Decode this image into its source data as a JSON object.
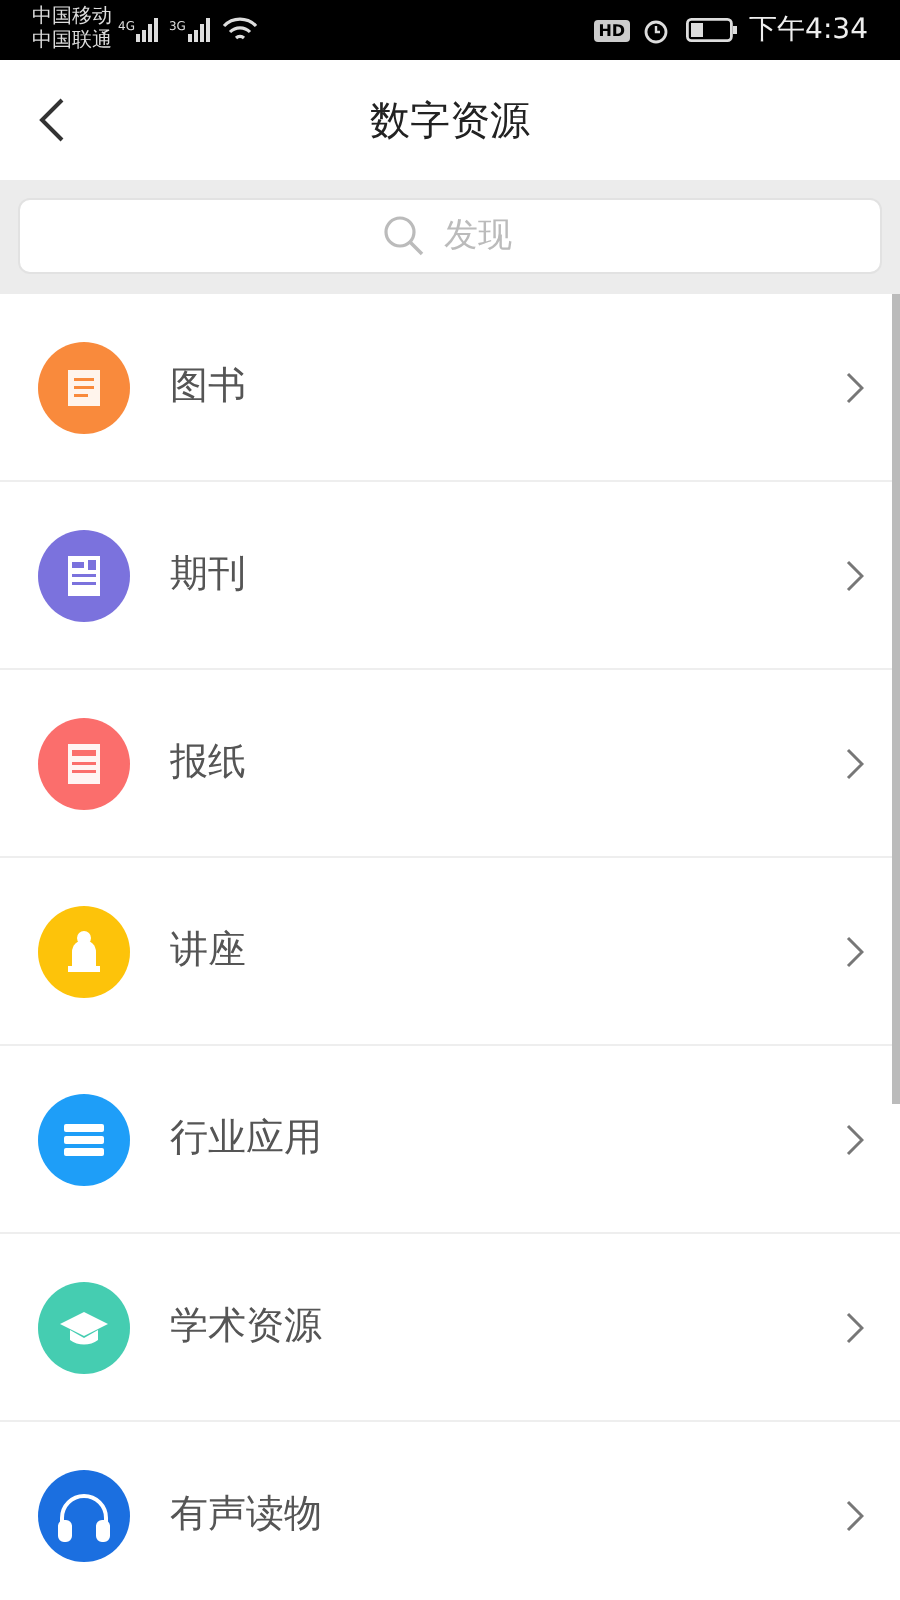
{
  "status_bar": {
    "carriers": [
      "中国移动",
      "中国联通"
    ],
    "networks": [
      "4G",
      "3G"
    ],
    "hd": "HD",
    "time": "下午4:34"
  },
  "header": {
    "title": "数字资源"
  },
  "search": {
    "placeholder": "发现"
  },
  "items": [
    {
      "label": "图书",
      "kind": "book",
      "color": "#f98a3c"
    },
    {
      "label": "期刊",
      "kind": "journal",
      "color": "#7b72dd"
    },
    {
      "label": "报纸",
      "kind": "newspaper",
      "color": "#fb6e6c"
    },
    {
      "label": "讲座",
      "kind": "lecture",
      "color": "#fdc30a"
    },
    {
      "label": "行业应用",
      "kind": "industry",
      "color": "#1e9ef8"
    },
    {
      "label": "学术资源",
      "kind": "academic",
      "color": "#45cdb1"
    },
    {
      "label": "有声读物",
      "kind": "audio",
      "color": "#1b6fe0"
    }
  ]
}
